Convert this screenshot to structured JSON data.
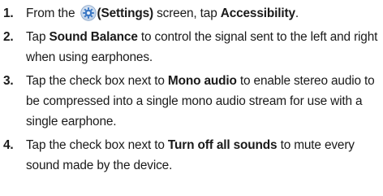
{
  "steps": [
    {
      "number": "1.",
      "parts": {
        "a": "From the ",
        "b": "(Settings)",
        "c": " screen, tap ",
        "d": "Accessibility",
        "e": "."
      }
    },
    {
      "number": "2.",
      "parts": {
        "a": "Tap ",
        "b": "Sound Balance",
        "c": " to control the signal sent to the left and right when using earphones."
      }
    },
    {
      "number": "3.",
      "parts": {
        "a": "Tap the check box next to ",
        "b": "Mono audio",
        "c": " to enable stereo audio to be compressed into a single mono audio stream for use with a single earphone."
      }
    },
    {
      "number": "4.",
      "parts": {
        "a": "Tap the check box next to ",
        "b": "Turn off all sounds",
        "c": " to mute every sound made by the device."
      }
    }
  ],
  "icons": {
    "settings": "settings-gear-icon"
  },
  "colors": {
    "text": "#1a1a1a",
    "icon_blue": "#3b78c4"
  }
}
